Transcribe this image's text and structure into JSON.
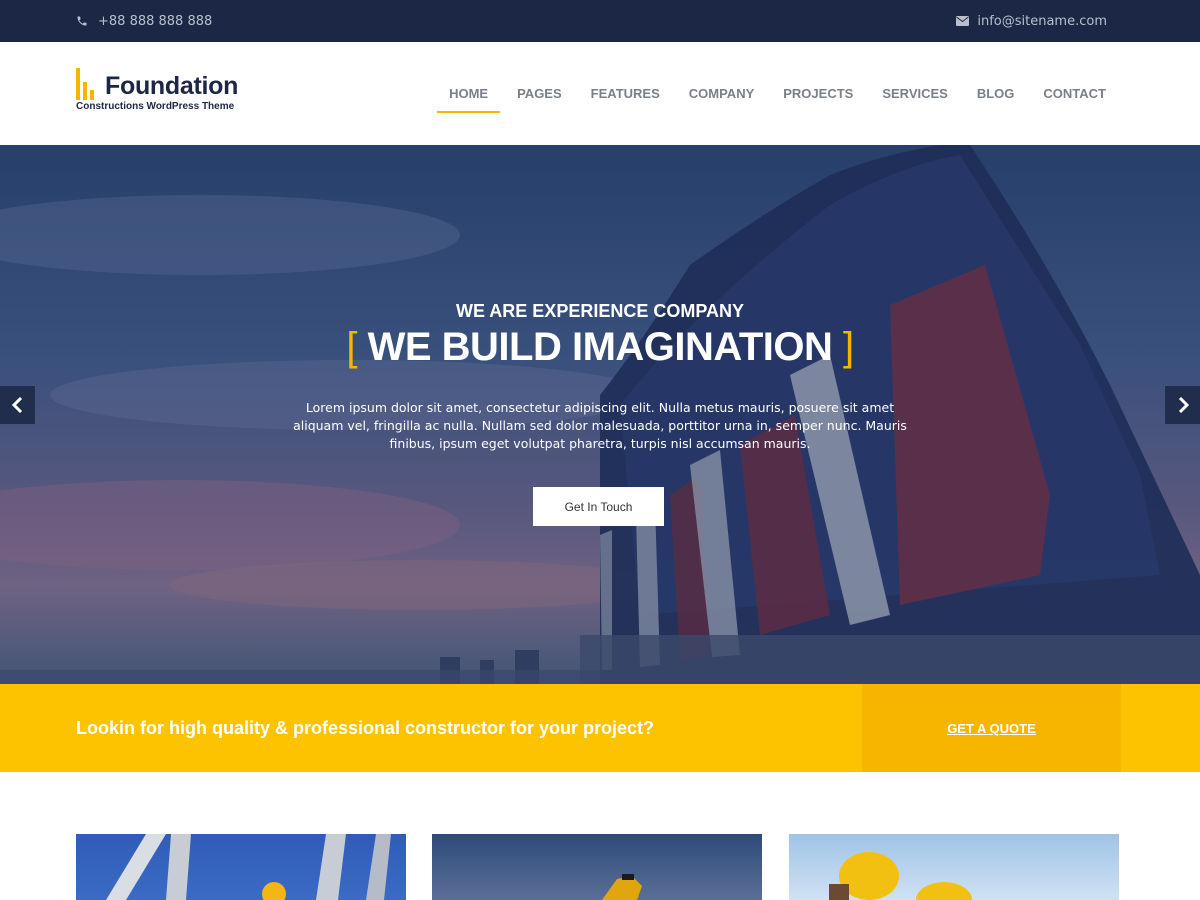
{
  "topbar": {
    "phone": "+88 888 888 888",
    "email": "info@sitename.com",
    "phone_icon": "phone-icon",
    "email_icon": "envelope-icon"
  },
  "logo": {
    "name": "Foundation",
    "tagline": "Constructions WordPress Theme"
  },
  "nav": {
    "items": [
      {
        "label": "HOME",
        "active": true
      },
      {
        "label": "PAGES"
      },
      {
        "label": "FEATURES"
      },
      {
        "label": "COMPANY"
      },
      {
        "label": "PROJECTS"
      },
      {
        "label": "SERVICES"
      },
      {
        "label": "BLOG"
      },
      {
        "label": "CONTACT"
      }
    ]
  },
  "hero": {
    "pre_title": "WE ARE EXPERIENCE COMPANY",
    "title": "WE BUILD IMAGINATION",
    "title_bracket_open": "[",
    "title_bracket_close": "]",
    "description": "Lorem ipsum dolor sit amet, consectetur adipiscing elit. Nulla metus mauris, posuere sit amet aliquam vel, fringilla ac nulla. Nullam sed dolor malesuada, porttitor urna in, semper nunc. Mauris finibus, ipsum eget volutpat pharetra, turpis nisl accumsan mauris.",
    "button_label": "Get In Touch",
    "prev_icon": "chevron-left-icon",
    "next_icon": "chevron-right-icon"
  },
  "cta": {
    "text": "Lookin for high quality & professional constructor for your project?",
    "button_label": "GET A QUOTE"
  },
  "colors": {
    "accent": "#f7b500",
    "cta_bg": "#fdc300",
    "navy": "#1b2744"
  }
}
